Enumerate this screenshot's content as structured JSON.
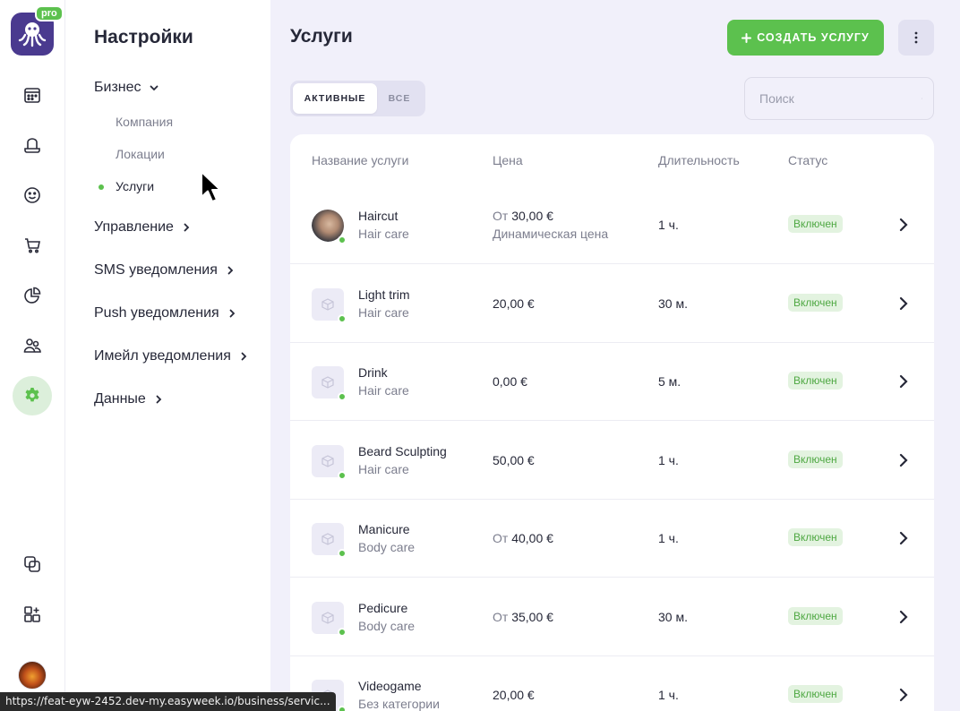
{
  "logo": {
    "badge": "pro"
  },
  "rail": {
    "icons": [
      "calendar-icon",
      "hat-icon",
      "smiley-icon",
      "cart-icon",
      "pie-chart-icon",
      "users-icon",
      "gear-icon",
      "copy-icon",
      "add-app-icon"
    ],
    "active": "gear-icon"
  },
  "settings": {
    "title": "Настройки",
    "business": "Бизнес",
    "sub": [
      "Компания",
      "Локации",
      "Услуги"
    ],
    "management": "Управление",
    "sms": "SMS уведомления",
    "push": "Push уведомления",
    "email": "Имейл уведомления",
    "data": "Данные"
  },
  "page": {
    "title": "Услуги",
    "create_label": "СОЗДАТЬ УСЛУГУ",
    "tabs": {
      "active": "АКТИВНЫЕ",
      "all": "ВСЕ"
    },
    "search_placeholder": "Поиск"
  },
  "table": {
    "headers": {
      "name": "Название услуги",
      "price": "Цена",
      "duration": "Длительность",
      "status": "Статус"
    },
    "rows": [
      {
        "name": "Haircut",
        "category": "Hair care",
        "price_prefix": "От",
        "price": "30,00 €",
        "price_note": "Динамическая цена",
        "duration": "1 ч.",
        "status": "Включен"
      },
      {
        "name": "Light trim",
        "category": "Hair care",
        "price_prefix": "",
        "price": "20,00 €",
        "price_note": "",
        "duration": "30 м.",
        "status": "Включен"
      },
      {
        "name": "Drink",
        "category": "Hair care",
        "price_prefix": "",
        "price": "0,00 €",
        "price_note": "",
        "duration": "5 м.",
        "status": "Включен"
      },
      {
        "name": "Beard Sculpting",
        "category": "Hair care",
        "price_prefix": "",
        "price": "50,00 €",
        "price_note": "",
        "duration": "1 ч.",
        "status": "Включен"
      },
      {
        "name": "Manicure",
        "category": "Body care",
        "price_prefix": "От",
        "price": "40,00 €",
        "price_note": "",
        "duration": "1 ч.",
        "status": "Включен"
      },
      {
        "name": "Pedicure",
        "category": "Body care",
        "price_prefix": "От",
        "price": "35,00 €",
        "price_note": "",
        "duration": "30 м.",
        "status": "Включен"
      },
      {
        "name": "Videogame",
        "category": "Без категории",
        "price_prefix": "",
        "price": "20,00 €",
        "price_note": "",
        "duration": "1 ч.",
        "status": "Включен"
      }
    ]
  },
  "status_url": "https://feat-eyw-2452.dev-my.easyweek.io/business/servic...",
  "colors": {
    "accent": "#5cc14e",
    "brand": "#4a3a8f",
    "background": "#f1f0fa"
  }
}
